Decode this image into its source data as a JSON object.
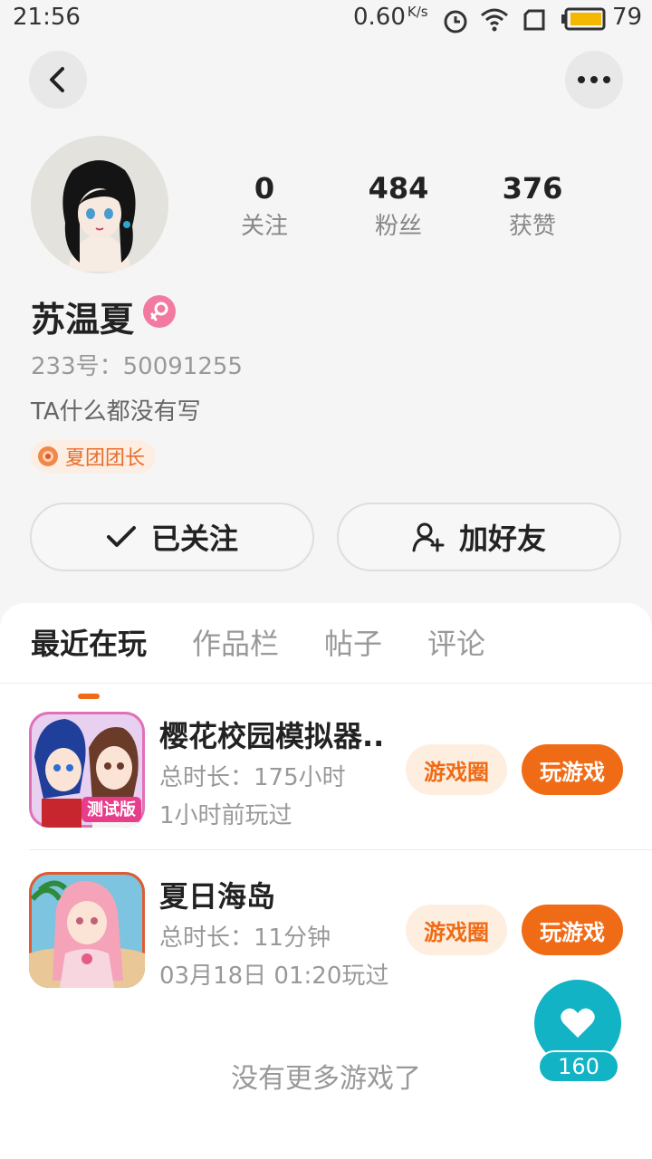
{
  "status_bar": {
    "time": "21:56",
    "net_speed": "0.60",
    "net_unit": "K/s",
    "battery": "79",
    "icons": [
      "alarm-icon",
      "wifi-icon",
      "sim-icon",
      "battery-icon"
    ]
  },
  "profile": {
    "name": "苏温夏",
    "gender": "female",
    "id_line": "233号：50091255",
    "bio": "TA什么都没有写",
    "tag": "夏团团长",
    "stats": [
      {
        "value": "0",
        "label": "关注"
      },
      {
        "value": "484",
        "label": "粉丝"
      },
      {
        "value": "376",
        "label": "获赞"
      }
    ],
    "follow_label": "已关注",
    "add_friend_label": "加好友"
  },
  "tabs": [
    {
      "label": "最近在玩",
      "active": true
    },
    {
      "label": "作品栏",
      "active": false
    },
    {
      "label": "帖子",
      "active": false
    },
    {
      "label": "评论",
      "active": false
    }
  ],
  "games": [
    {
      "title": "樱花校园模拟器..",
      "duration": "总时长：175小时",
      "last_played": "1小时前玩过",
      "icon_badge": "测试版",
      "circle_label": "游戏圈",
      "play_label": "玩游戏"
    },
    {
      "title": "夏日海岛",
      "duration": "总时长：11分钟",
      "last_played": "03月18日 01:20玩过",
      "circle_label": "游戏圈",
      "play_label": "玩游戏"
    }
  ],
  "no_more_text": "没有更多游戏了",
  "like": {
    "count": "160"
  },
  "colors": {
    "accent": "#f06b16",
    "accent_light": "#fdeee0",
    "like": "#11b3c4",
    "gender": "#f27aa0"
  }
}
